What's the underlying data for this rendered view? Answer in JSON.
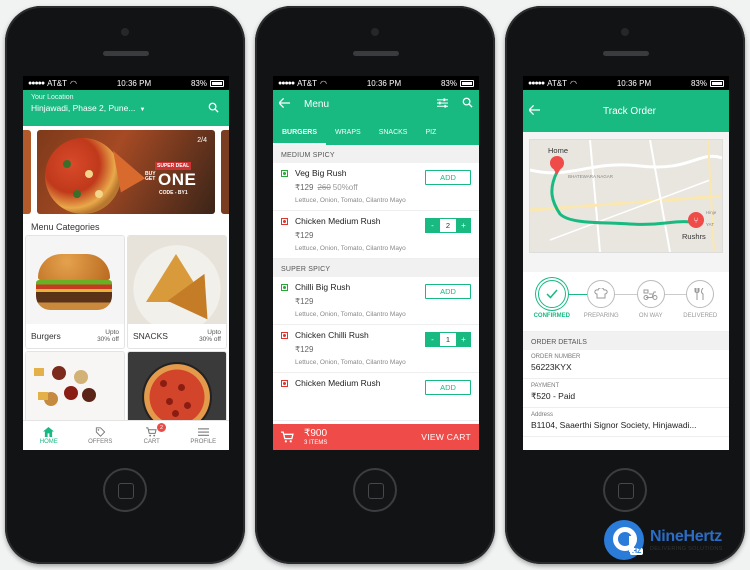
{
  "accent": "#19b982",
  "cart_bar_color": "#ef4c49",
  "status": {
    "carrier": "AT&T",
    "time": "10:36 PM",
    "battery": "83%"
  },
  "home": {
    "location_label": "Your Location",
    "location_value": "Hinjawadi, Phase 2, Pune...",
    "banner": {
      "pager": "2/4",
      "super_deal": "SUPER DEAL",
      "buy": "BUY",
      "get": "GET",
      "one": "ONE",
      "code": "CODE - BY1"
    },
    "categories_title": "Menu Categories",
    "categories": [
      {
        "name": "Burgers",
        "offer_1": "Upto",
        "offer_2": "30% off"
      },
      {
        "name": "SNACKS",
        "offer_1": "Upto",
        "offer_2": "30% off"
      }
    ],
    "tabs": [
      {
        "label": "HOME",
        "icon": "home-icon"
      },
      {
        "label": "OFFERS",
        "icon": "tag-icon"
      },
      {
        "label": "CART",
        "icon": "cart-icon",
        "badge": "2"
      },
      {
        "label": "PROFILE",
        "icon": "menu-icon"
      }
    ]
  },
  "menu": {
    "title": "Menu",
    "tabs": [
      "BURGERS",
      "WRAPS",
      "SNACKS",
      "PIZ"
    ],
    "sections": [
      {
        "title": "MEDIUM SPICY",
        "items": [
          {
            "name": "Veg Big Rush",
            "price": "₹129",
            "old_price": "260",
            "discount": "50%off",
            "desc": "Lettuce, Onion, Tomato, Cilantro Mayo",
            "type": "veg",
            "action": "ADD"
          },
          {
            "name": "Chicken Medium Rush",
            "price": "₹129",
            "desc": "Lettuce, Onion, Tomato, Cilantro Mayo",
            "type": "nonveg",
            "qty": "2",
            "minus": "-",
            "plus": "+"
          }
        ]
      },
      {
        "title": "SUPER SPICY",
        "items": [
          {
            "name": "Chilli Big Rush",
            "price": "₹129",
            "desc": "Lettuce, Onion, Tomato, Cilantro Mayo",
            "type": "veg",
            "action": "ADD"
          },
          {
            "name": "Chicken Chilli Rush",
            "price": "₹129",
            "desc": "Lettuce, Onion, Tomato, Cilantro Mayo",
            "type": "nonveg",
            "qty": "1",
            "minus": "-",
            "plus": "+"
          },
          {
            "name": "Chicken Medium Rush",
            "type": "nonveg",
            "action": "ADD"
          }
        ]
      }
    ],
    "cart": {
      "total": "₹900",
      "count": "3 ITEMS",
      "cta": "VIEW CART"
    }
  },
  "track": {
    "title": "Track Order",
    "map": {
      "home_label": "Home",
      "restaurant_label": "Rushrs",
      "area_1": "BHATEWARA NAGAR",
      "area_2": "YAT",
      "area_3": "Hinje"
    },
    "steps": [
      {
        "label": "CONFIRMED",
        "icon": "check-icon",
        "done": true
      },
      {
        "label": "PREPARING",
        "icon": "chef-icon",
        "done": false
      },
      {
        "label": "ON WAY",
        "icon": "scooter-icon",
        "done": false
      },
      {
        "label": "DELIVERED",
        "icon": "cutlery-icon",
        "done": false
      }
    ],
    "details_title": "ORDER DETAILS",
    "details": [
      {
        "key": "ORDER NUMBER",
        "value": "56223KYX"
      },
      {
        "key": "PAYMENT",
        "value": "₹520 - Paid"
      },
      {
        "key": "Address",
        "value": "B1104, Saaerthi Signor Society, Hinjawadi..."
      }
    ]
  },
  "brand": {
    "name": "NineHertz",
    "tagline": "DELIVERING SOLUTIONS",
    "mark": "HZ"
  }
}
